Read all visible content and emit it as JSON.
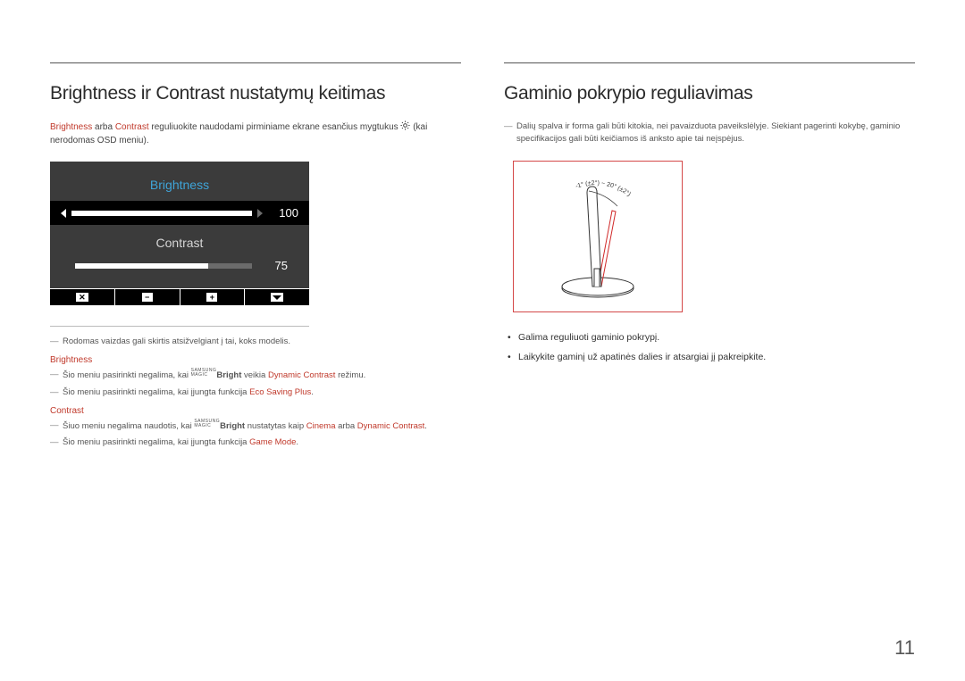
{
  "left": {
    "heading": "Brightness ir Contrast nustatymų keitimas",
    "intro_1a": "Brightness",
    "intro_1b": " arba ",
    "intro_1c": "Contrast",
    "intro_1d": " reguliuokite naudodami pirminiame ekrane esančius mygtukus ",
    "intro_1e": " (kai nerodomas OSD meniu).",
    "osd": {
      "brightness_label": "Brightness",
      "brightness_value": "100",
      "contrast_label": "Contrast",
      "contrast_value": "75"
    },
    "note1": "Rodomas vaizdas gali skirtis atsižvelgiant į tai, koks modelis.",
    "sub_brightness": "Brightness",
    "b_note1_a": "Šio meniu pasirinkti negalima, kai ",
    "brand_top": "SAMSUNG",
    "brand_bot": "MAGIC",
    "brand_suffix": "Bright",
    "b_note1_b": " veikia ",
    "b_note1_c": "Dynamic Contrast",
    "b_note1_d": " režimu.",
    "b_note2_a": "Šio meniu pasirinkti negalima, kai įjungta funkcija ",
    "b_note2_b": "Eco Saving Plus",
    "b_note2_c": ".",
    "sub_contrast": "Contrast",
    "c_note1_a": "Šiuo meniu negalima naudotis, kai ",
    "c_note1_b": " nustatytas kaip ",
    "c_note1_c": "Cinema",
    "c_note1_d": " arba ",
    "c_note1_e": "Dynamic Contrast",
    "c_note1_f": ".",
    "c_note2_a": "Šio meniu pasirinkti negalima, kai įjungta funkcija ",
    "c_note2_b": "Game Mode",
    "c_note2_c": "."
  },
  "right": {
    "heading": "Gaminio pokrypio reguliavimas",
    "note1": "Dalių spalva ir forma gali būti kitokia, nei pavaizduota paveikslėlyje. Siekiant pagerinti kokybę, gaminio specifikacijos gali būti keičiamos iš anksto apie tai neįspėjus.",
    "tilt_label": "-1° (±2°) ~ 20° (±2°)",
    "bullet1": "Galima reguliuoti gaminio pokrypį.",
    "bullet2": "Laikykite gaminį už apatinės dalies ir atsargiai jį pakreipkite."
  },
  "page_number": "11"
}
